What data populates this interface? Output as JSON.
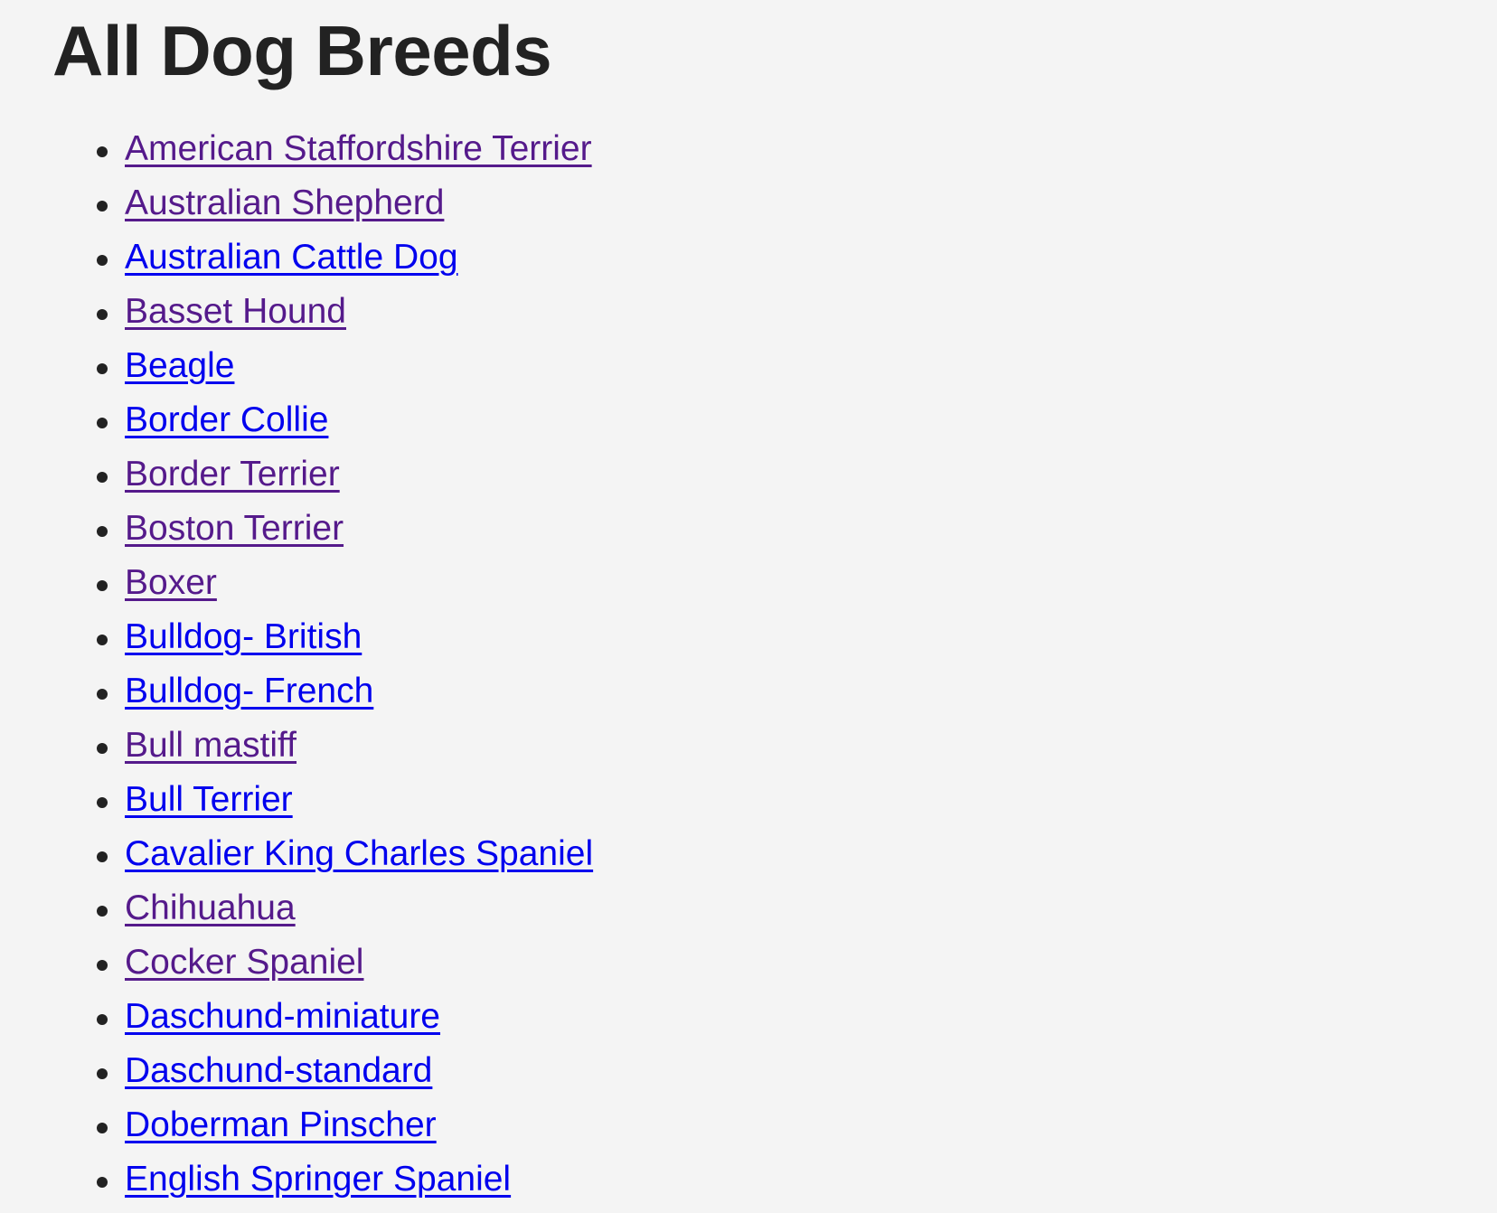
{
  "page": {
    "title": "All Dog Breeds"
  },
  "colors": {
    "background": "#f4f4f4",
    "text": "#222222",
    "link": "#0000ee",
    "link_visited": "#551a8b"
  },
  "breeds": [
    {
      "label": "American Staffordshire Terrier",
      "visited": true
    },
    {
      "label": "Australian Shepherd",
      "visited": true
    },
    {
      "label": "Australian Cattle Dog",
      "visited": false
    },
    {
      "label": "Basset Hound",
      "visited": true
    },
    {
      "label": "Beagle",
      "visited": false
    },
    {
      "label": "Border Collie",
      "visited": false
    },
    {
      "label": "Border Terrier",
      "visited": true
    },
    {
      "label": "Boston Terrier",
      "visited": true
    },
    {
      "label": "Boxer",
      "visited": true
    },
    {
      "label": "Bulldog- British",
      "visited": false
    },
    {
      "label": "Bulldog- French",
      "visited": false
    },
    {
      "label": "Bull mastiff",
      "visited": true
    },
    {
      "label": "Bull Terrier",
      "visited": false
    },
    {
      "label": "Cavalier King Charles Spaniel",
      "visited": false
    },
    {
      "label": "Chihuahua",
      "visited": true
    },
    {
      "label": "Cocker Spaniel",
      "visited": true
    },
    {
      "label": "Daschund-miniature",
      "visited": false
    },
    {
      "label": "Daschund-standard",
      "visited": false
    },
    {
      "label": "Doberman Pinscher",
      "visited": false
    },
    {
      "label": "English Springer Spaniel",
      "visited": false
    }
  ]
}
